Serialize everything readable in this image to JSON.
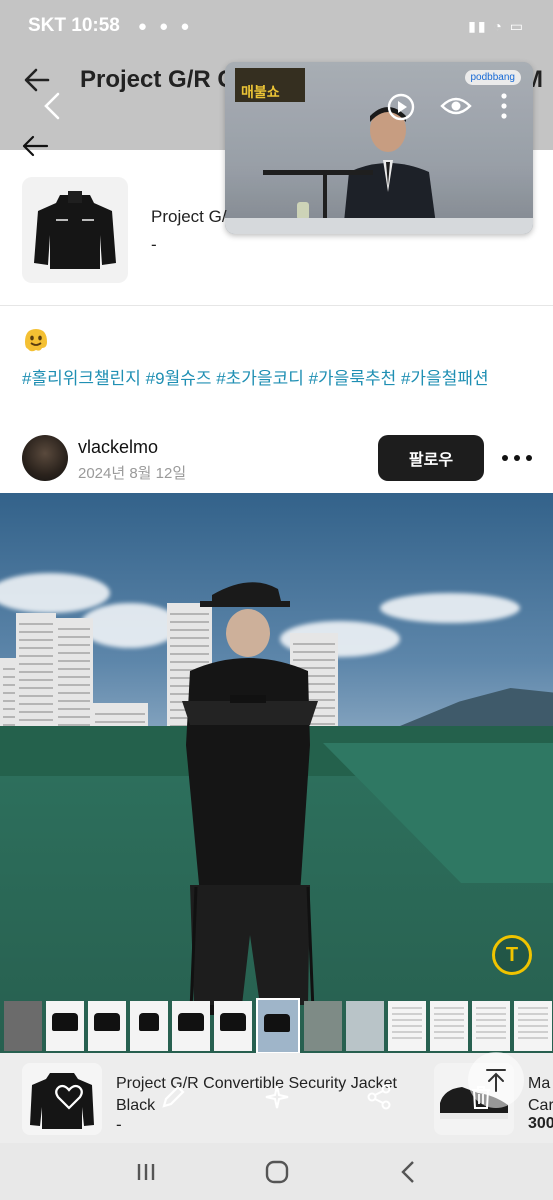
{
  "status_bar": {
    "carrier_time": "SKT 10:58",
    "right_icons": [
      "wifi-icon",
      "signal-icon",
      "battery-icon"
    ]
  },
  "header": {
    "title": "Project G/R C",
    "title_tail": "M"
  },
  "video_popup": {
    "badge": "매불쇼",
    "brand": "podbbang"
  },
  "product": {
    "name": "Project G/",
    "price": "-"
  },
  "post": {
    "hashtags": "#홀리위크챌린지 #9월슈즈 #초가을코디 #가을룩추천 #가을철패션"
  },
  "author": {
    "username": "vlackelmo",
    "date": "2024년 8월 12일",
    "follow_label": "팔로우"
  },
  "photo": {
    "ocr_label": "T"
  },
  "bottom_product": {
    "name": "Project G/R Convertible Security Jacket Black",
    "price": "-",
    "next_name_line1": "Ma",
    "next_name_line2": "Car",
    "next_price": "300"
  },
  "colors": {
    "hashtag": "#1f8fb3",
    "follow_button": "#1d1d1d",
    "ocr_accent": "#f0c400"
  }
}
